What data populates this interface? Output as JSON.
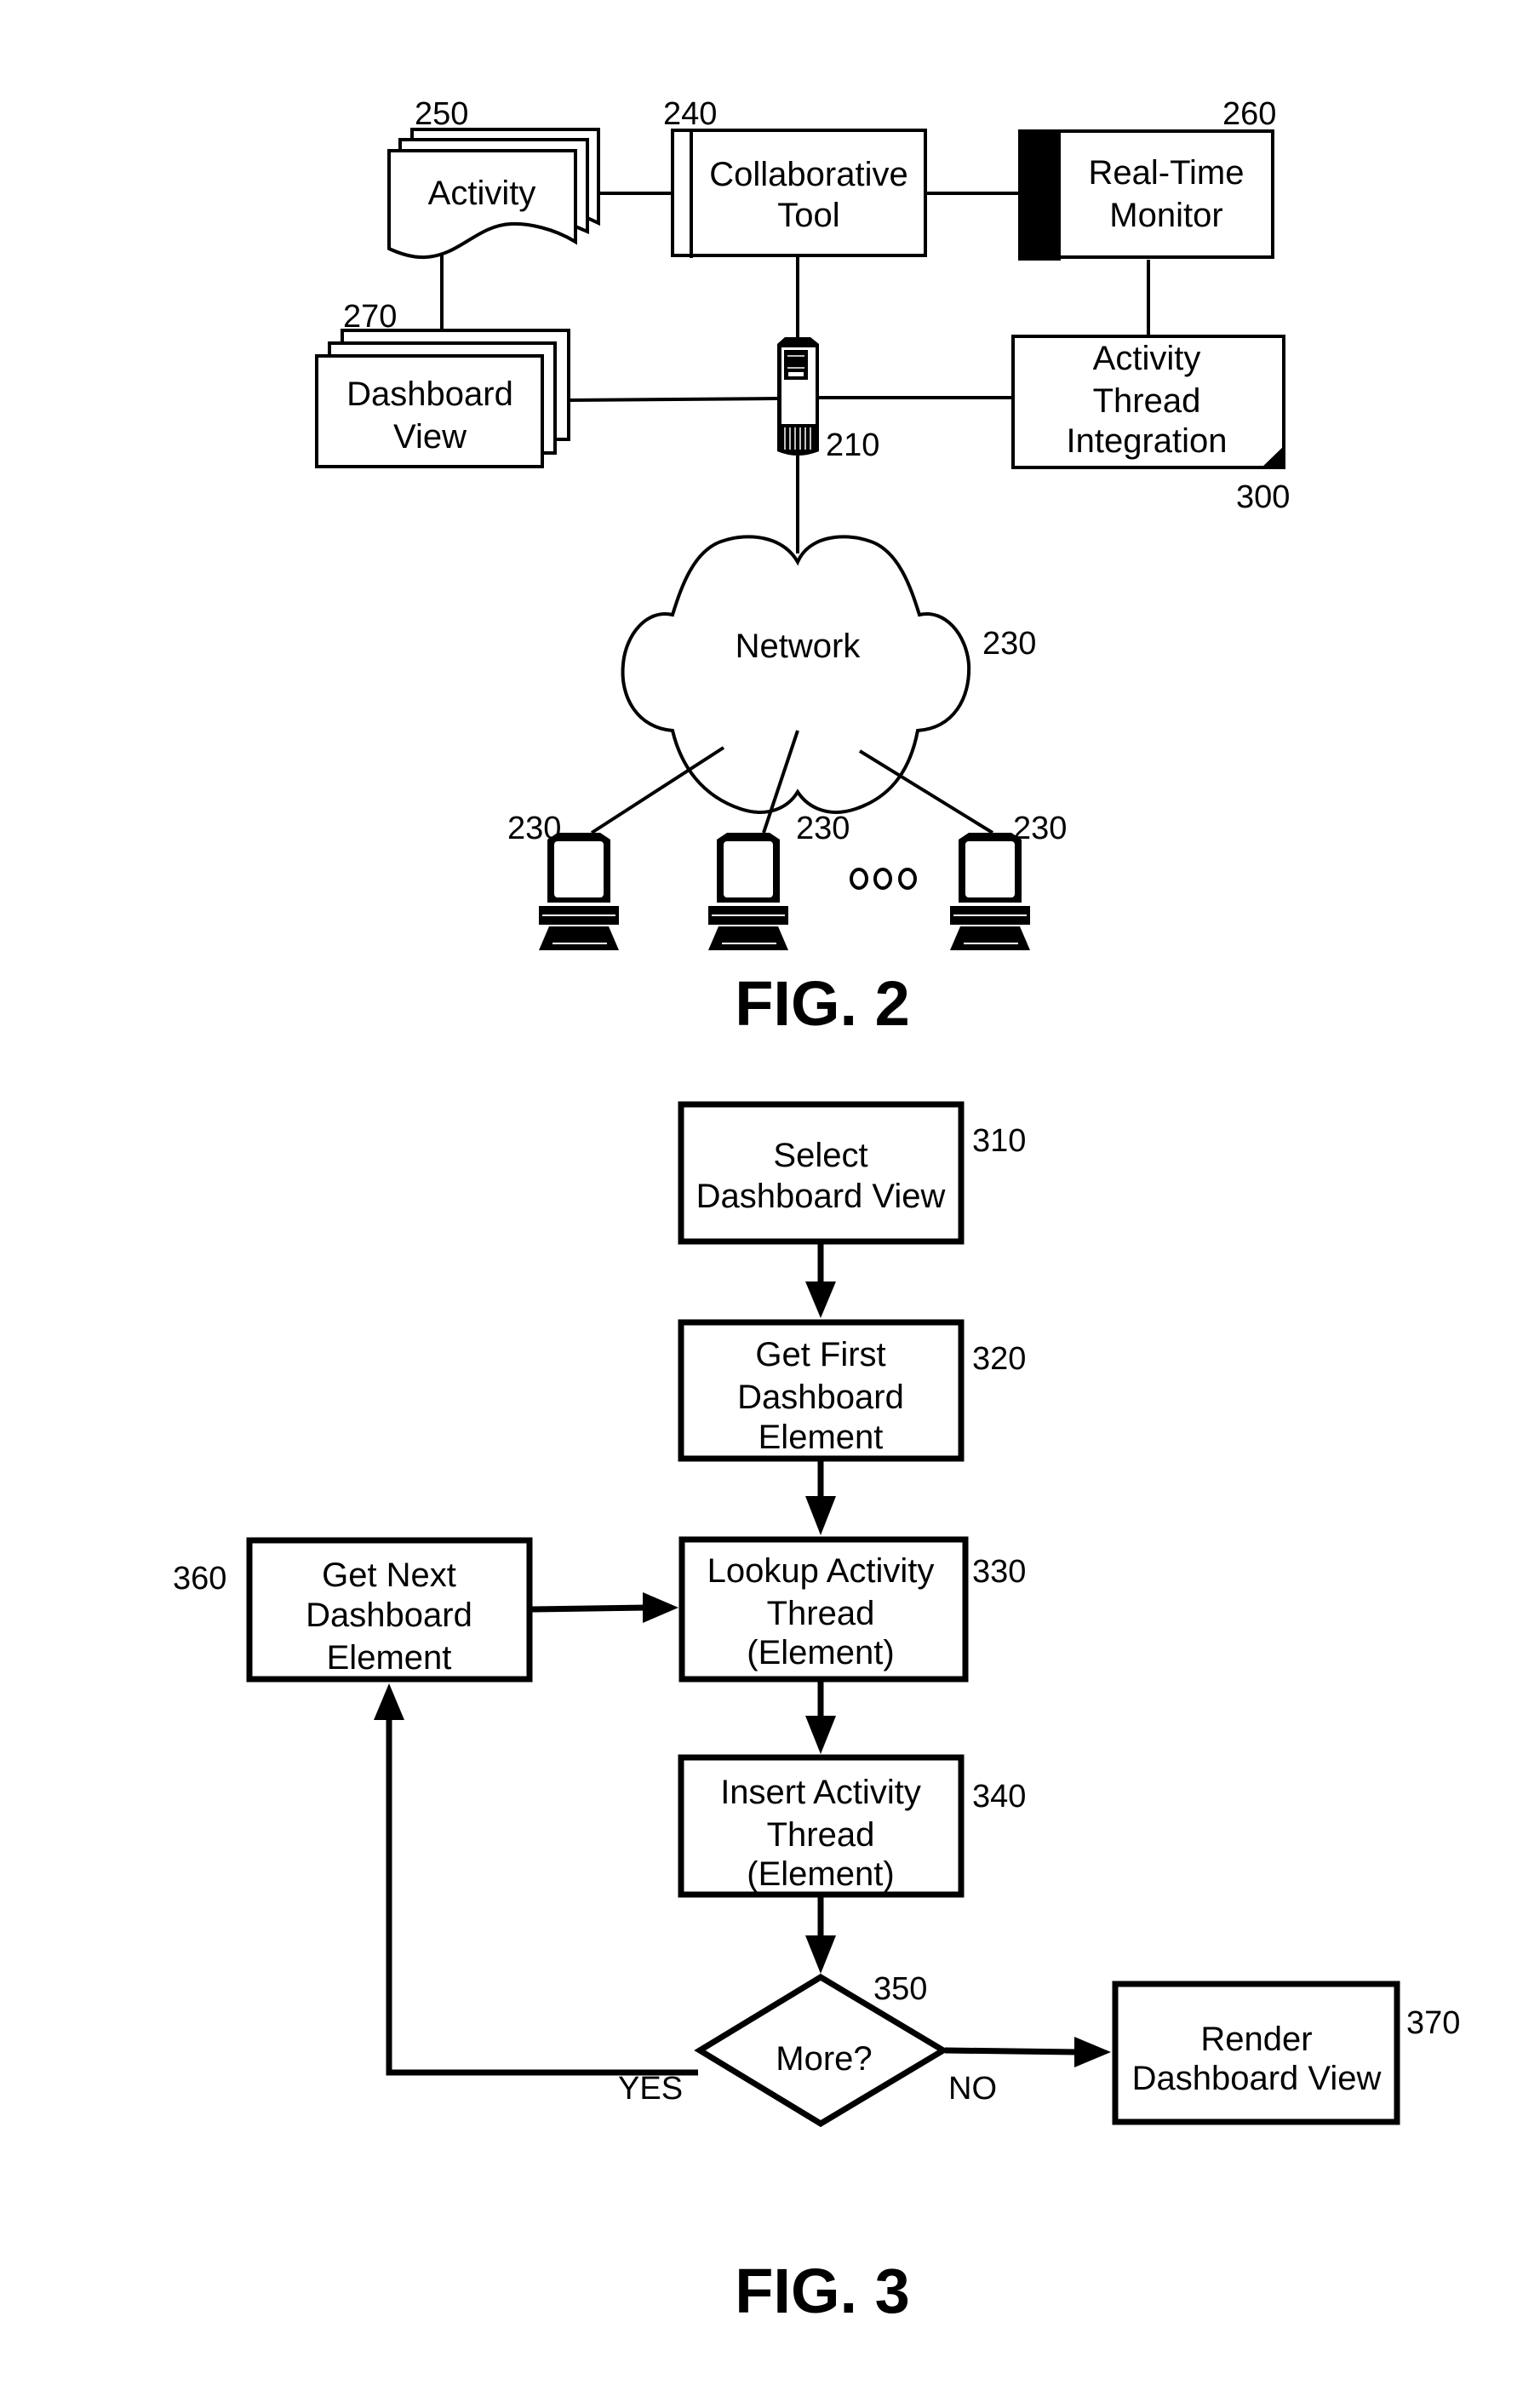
{
  "fig2": {
    "caption": "FIG. 2",
    "activity": {
      "label": "Activity",
      "ref": "250"
    },
    "collaborative_tool": {
      "lines": [
        "Collaborative",
        "Tool"
      ],
      "ref": "240"
    },
    "real_time_monitor": {
      "lines": [
        "Real-Time",
        "Monitor"
      ],
      "ref": "260"
    },
    "dashboard_view": {
      "lines": [
        "Dashboard",
        "View"
      ],
      "ref": "270"
    },
    "server": {
      "ref": "210"
    },
    "activity_thread_integration": {
      "lines": [
        "Activity",
        "Thread",
        "Integration"
      ],
      "ref": "300"
    },
    "network": {
      "label": "Network",
      "ref": "230"
    },
    "clients": [
      {
        "ref": "230"
      },
      {
        "ref": "230"
      },
      {
        "ref": "230"
      }
    ],
    "ellipsis": "ooo"
  },
  "fig3": {
    "caption": "FIG. 3",
    "steps": [
      {
        "id": "310",
        "lines": [
          "Select",
          "Dashboard View"
        ]
      },
      {
        "id": "320",
        "lines": [
          "Get First",
          "Dashboard",
          "Element"
        ]
      },
      {
        "id": "330",
        "lines": [
          "Lookup Activity",
          "Thread",
          "(Element)"
        ]
      },
      {
        "id": "340",
        "lines": [
          "Insert Activity",
          "Thread",
          "(Element)"
        ]
      },
      {
        "id": "350",
        "lines": [
          "More?"
        ]
      },
      {
        "id": "360",
        "lines": [
          "Get Next",
          "Dashboard",
          "Element"
        ]
      },
      {
        "id": "370",
        "lines": [
          "Render",
          "Dashboard View"
        ]
      }
    ],
    "yes_label": "YES",
    "no_label": "NO"
  }
}
